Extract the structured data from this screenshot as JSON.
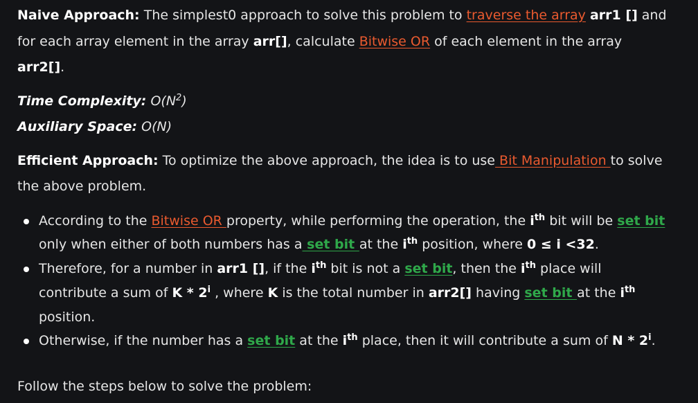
{
  "naive": {
    "heading": "Naive Approach:",
    "t1": " The simplest0 approach to solve this problem to ",
    "link1": "traverse the array",
    "t2": " ",
    "arr1": "arr1 []",
    "t3": " and for each array element in the array ",
    "arr": "arr[]",
    "t4": ", calculate ",
    "link2": "Bitwise OR",
    "t5": " of each element in the array ",
    "arr2": "arr2[]",
    "t6": "."
  },
  "complexity": {
    "time_label": "Time Complexity:",
    "time_value_a": " O(N",
    "time_value_sup": "2",
    "time_value_b": ")",
    "space_label": "Auxiliary Space:",
    "space_value": " O(N)"
  },
  "efficient": {
    "heading": "Efficient Approach:",
    "t1": " To optimize the above approach, the idea is to use",
    "link": " Bit Manipulation ",
    "t2": "to solve the above problem."
  },
  "bullets": {
    "b1": {
      "t1": "According to the ",
      "link1": "Bitwise OR ",
      "t2": "property, while performing the operation, the ",
      "i1": "i",
      "sup1": "th",
      "t3": " bit will be ",
      "link2": "set bit ",
      "t4": "only when either of both numbers has a",
      "link3": " set bit ",
      "t5": "at the ",
      "i2": "i",
      "sup2": "th",
      "t6": " position, where ",
      "cond": "0 ≤ i <32",
      "t7": "."
    },
    "b2": {
      "t1": "Therefore, for a number in ",
      "arr1": "arr1 []",
      "t2": ", if the ",
      "i1": "i",
      "sup1": "th",
      "t3": " bit is not a ",
      "link1": "set bit",
      "t4": ", then the ",
      "i2": "i",
      "sup2": "th",
      "t5": " place will contribute a sum of ",
      "expr": "K * 2",
      "expr_sup": "i",
      "t6": " , where ",
      "k": "K",
      "t7": " is the total number in ",
      "arr2": "arr2[]",
      "t8": " having ",
      "link2": "set bit ",
      "t9": "at the ",
      "i3": "i",
      "sup3": "th",
      "t10": " position."
    },
    "b3": {
      "t1": "Otherwise, if the number has a ",
      "link1": "set bit",
      "t2": " at the ",
      "i1": "i",
      "sup1": "th",
      "t3": " place, then it will contribute a sum of ",
      "expr": "N * 2",
      "expr_sup": "i",
      "t4": "."
    }
  },
  "follow": "Follow the steps below to solve the problem:",
  "colors": {
    "background": "#131417",
    "text": "#e6e6e6",
    "link_red": "#ea5a2f",
    "link_green": "#2fa84a"
  }
}
